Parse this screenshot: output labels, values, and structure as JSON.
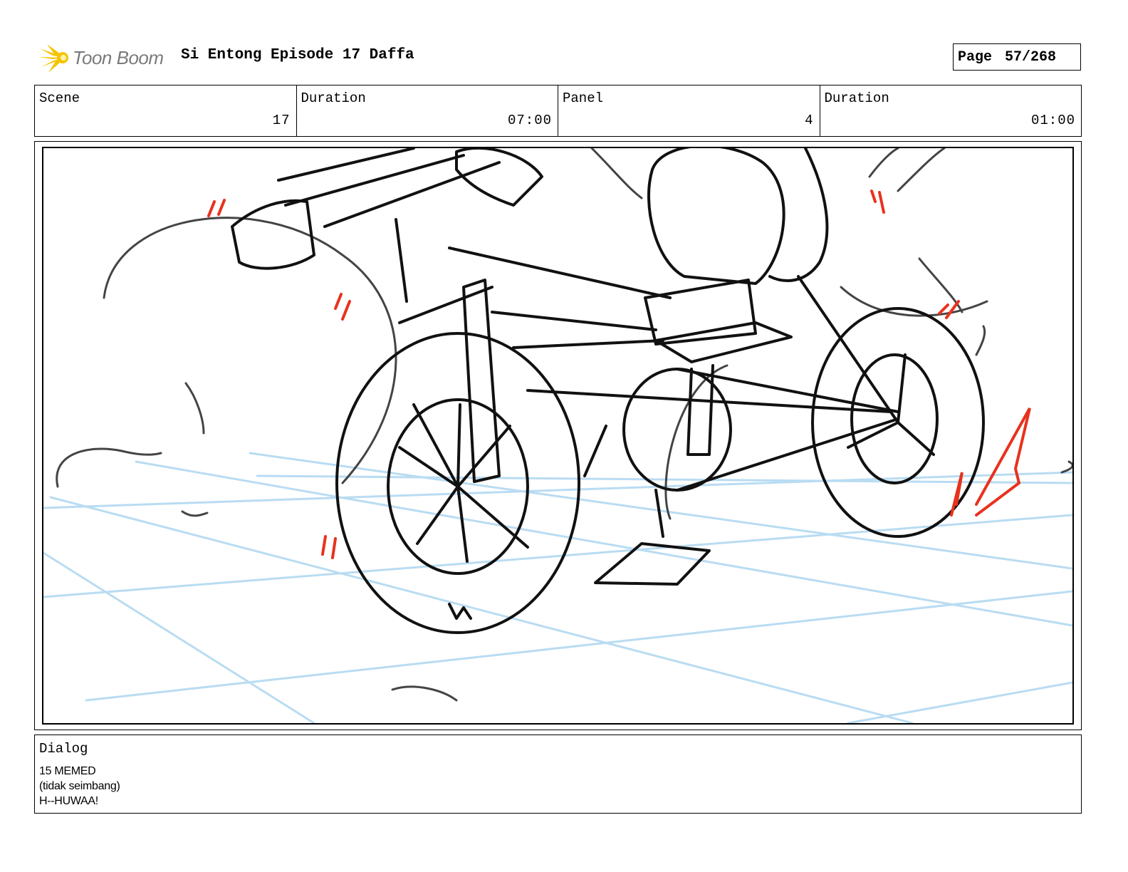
{
  "header": {
    "logo_text": "Toon Boom",
    "project_title": "Si Entong Episode 17 Daffa",
    "page_label": "Page",
    "page_number": "57/268"
  },
  "info": {
    "scene_label": "Scene",
    "scene_value": "17",
    "scene_duration_label": "Duration",
    "scene_duration_value": "07:00",
    "panel_label": "Panel",
    "panel_value": "4",
    "panel_duration_label": "Duration",
    "panel_duration_value": "01:00"
  },
  "dialog": {
    "label": "Dialog",
    "lines": [
      "15 MEMED",
      "(tidak seimbang)",
      "H--HUWAA!"
    ]
  },
  "colors": {
    "logo_yellow": "#f5c400",
    "logo_text": "#7a7a7a",
    "guide_blue": "#b9dcf2",
    "accent_red": "#e8321e",
    "ink": "#111111"
  }
}
